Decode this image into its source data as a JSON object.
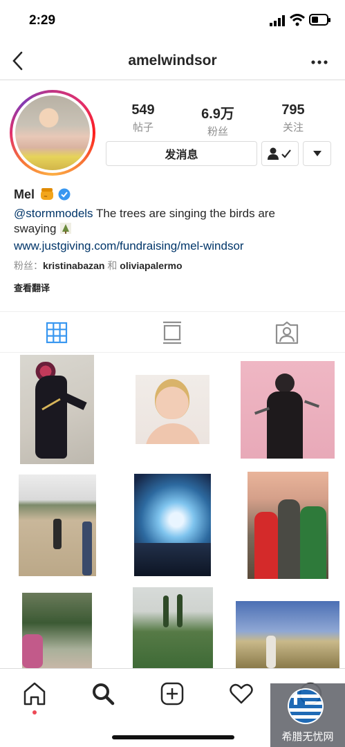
{
  "status_bar": {
    "time": "2:29"
  },
  "nav": {
    "title": "amelwindsor"
  },
  "stats": [
    {
      "value": "549",
      "label": "帖子"
    },
    {
      "value": "6.9万",
      "label": "粉丝"
    },
    {
      "value": "795",
      "label": "关注"
    }
  ],
  "buttons": {
    "message": "发消息"
  },
  "bio": {
    "name": "Mel",
    "mention": "@stormmodels",
    "text": " The trees are singing the birds are",
    "text2": "swaying",
    "link": "www.justgiving.com/fundraising/mel-windsor",
    "followed_prefix": "粉丝：",
    "followed_user1": "kristinabazan",
    "followed_and": "和",
    "followed_user2": "oliviapalermo",
    "translate": "查看翻译"
  },
  "watermark": {
    "text": "希腊无忧网"
  },
  "colors": {
    "verified": "#3897f0",
    "link": "#003569",
    "active_tab": "#3897f0",
    "notification_dot": "#ed4956"
  }
}
